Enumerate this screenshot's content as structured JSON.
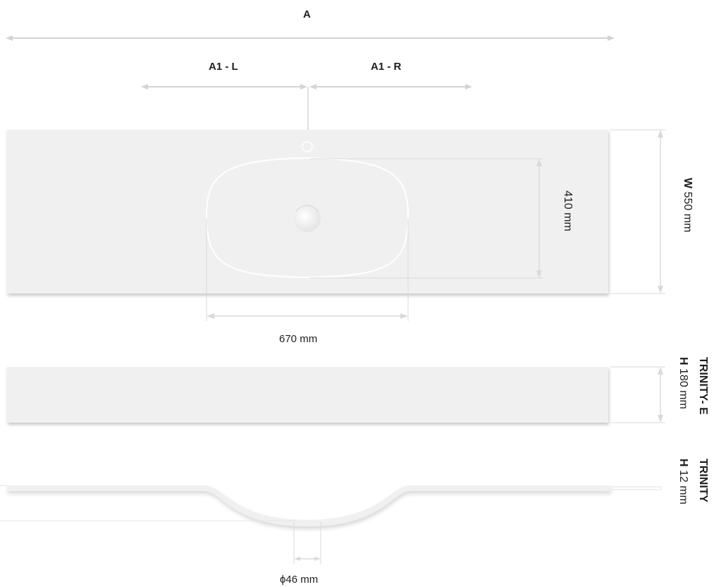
{
  "labels": {
    "total_width": "A",
    "left_section": "A1 - L",
    "right_section": "A1 - R",
    "basin_depth": "410 mm",
    "basin_width": "670 mm",
    "drain_diameter": "ϕ46 mm",
    "top_width_prefix": "W",
    "top_width_value": "550 mm",
    "model_e_name": "TRINITY- E",
    "model_e_height_prefix": "H",
    "model_e_height_value": "180 mm",
    "model_name": "TRINITY",
    "model_height_prefix": "H",
    "model_height_value": "12 mm"
  },
  "colors": {
    "surface": "#f0f0f0",
    "dimension_line": "#d4d4d4",
    "text": "#1f1f1f",
    "basin_outline": "#ffffff"
  }
}
